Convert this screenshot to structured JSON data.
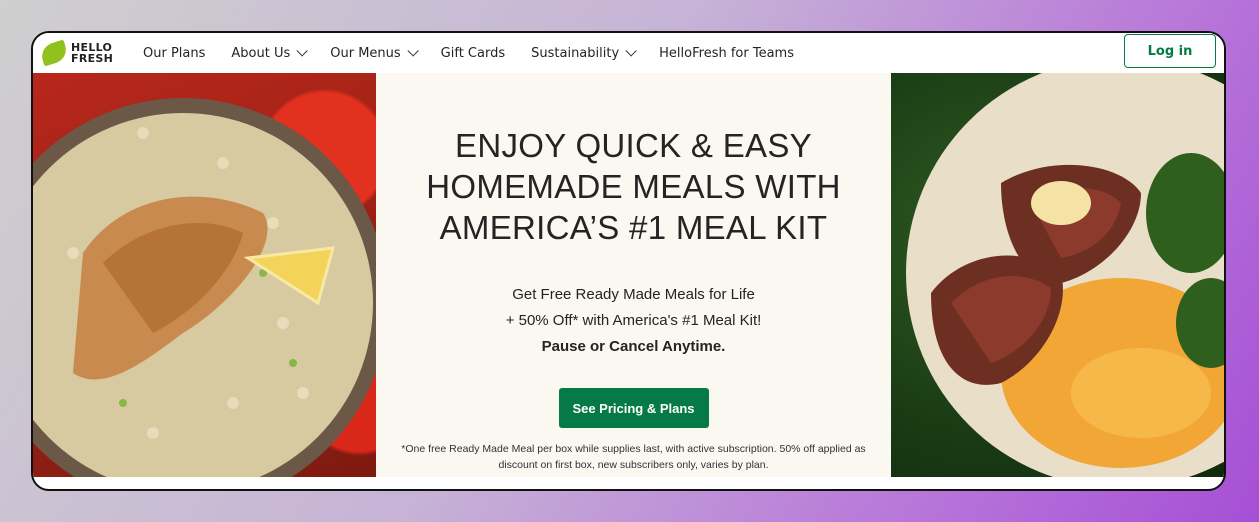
{
  "brand": {
    "line1": "HELLO",
    "line2": "FRESH"
  },
  "nav": {
    "items": [
      {
        "label": "Our Plans",
        "dropdown": false
      },
      {
        "label": "About Us",
        "dropdown": true
      },
      {
        "label": "Our Menus",
        "dropdown": true
      },
      {
        "label": "Gift Cards",
        "dropdown": false
      },
      {
        "label": "Sustainability",
        "dropdown": true
      },
      {
        "label": "HelloFresh for Teams",
        "dropdown": false
      }
    ],
    "login_label": "Log in"
  },
  "hero": {
    "headline_lines": [
      "ENJOY QUICK & EASY",
      "HOMEMADE MEALS WITH",
      "AMERICA’S #1 MEAL KIT"
    ],
    "sub_line1": "Get Free Ready Made Meals for Life",
    "sub_line2": "+ 50% Off* with America's #1 Meal Kit!",
    "sub_line3": "Pause or Cancel Anytime.",
    "cta_label": "See Pricing & Plans",
    "fine_print": "*One free Ready Made Meal per box while supplies last, with active subscription. 50% off applied as discount on first box, new subscribers only, varies by plan."
  },
  "colors": {
    "brand_green": "#067a46",
    "leaf_green": "#91c11e",
    "hero_bg": "#fbf7f1"
  },
  "icons": {
    "logo": "leaf-icon",
    "dropdown": "chevron-down-icon"
  }
}
